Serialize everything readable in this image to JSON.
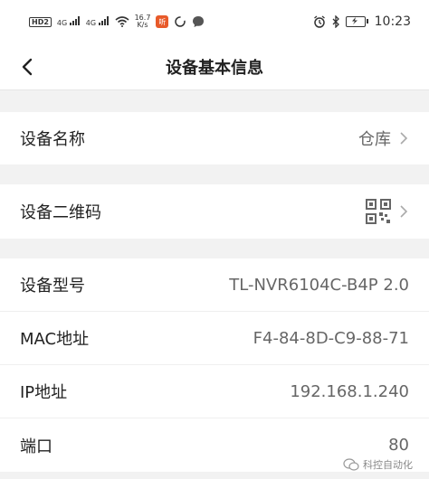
{
  "status_bar": {
    "hd_badge": "HD2",
    "network_1": "4G",
    "network_2": "4G",
    "speed_value": "16.7",
    "speed_unit": "K/s",
    "app_badge": "听",
    "time": "10:23"
  },
  "nav": {
    "title": "设备基本信息"
  },
  "device_name_row": {
    "label": "设备名称",
    "value": "仓库"
  },
  "qr_row": {
    "label": "设备二维码"
  },
  "info": [
    {
      "label": "设备型号",
      "value": "TL-NVR6104C-B4P 2.0"
    },
    {
      "label": "MAC地址",
      "value": "F4-84-8D-C9-88-71"
    },
    {
      "label": "IP地址",
      "value": "192.168.1.240"
    },
    {
      "label": "端口",
      "value": "80"
    }
  ],
  "watermark": {
    "text": "科控自动化"
  },
  "colors": {
    "background": "#f2f2f2",
    "surface": "#ffffff",
    "text": "#222222",
    "secondary_text": "#666666"
  }
}
